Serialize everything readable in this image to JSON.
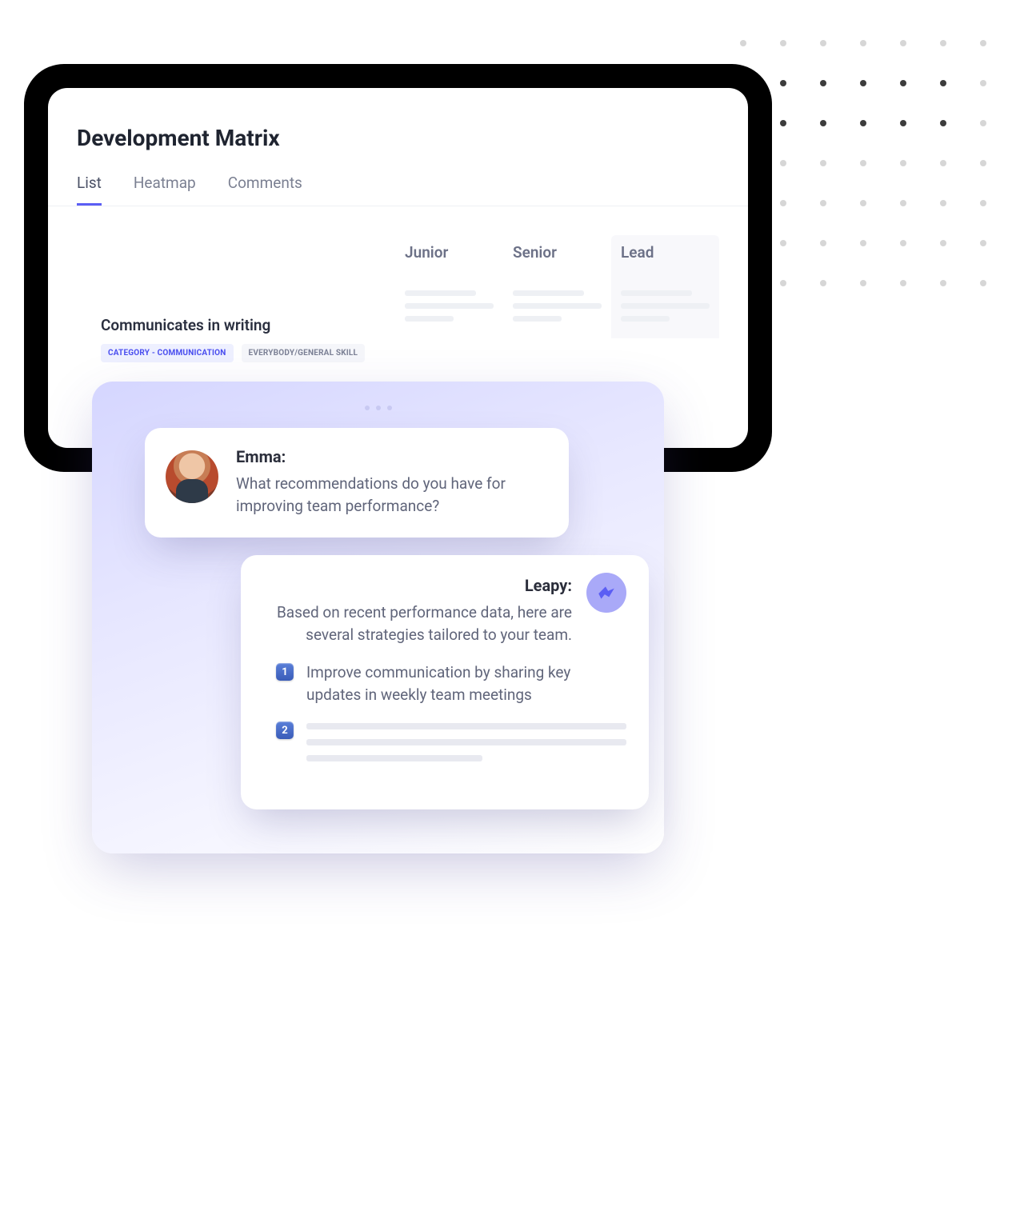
{
  "page": {
    "title": "Development Matrix"
  },
  "tabs": [
    {
      "label": "List",
      "active": true
    },
    {
      "label": "Heatmap",
      "active": false
    },
    {
      "label": "Comments",
      "active": false
    }
  ],
  "matrix": {
    "columns": [
      "Junior",
      "Senior",
      "Lead"
    ],
    "skill": {
      "title": "Communicates in writing",
      "badges": [
        {
          "text": "CATEGORY - COMMUNICATION",
          "variant": "primary"
        },
        {
          "text": "EVERYBODY/GENERAL SKILL",
          "variant": "default"
        }
      ]
    }
  },
  "chat": {
    "user": {
      "name": "Emma:",
      "message": "What recommendations do you have for improving team performance?"
    },
    "bot": {
      "name": "Leapy:",
      "intro": "Based on recent performance data, here are several strategies tailored to your team.",
      "items": [
        {
          "num": "1",
          "text": "Improve communication by sharing key updates in weekly team meetings"
        },
        {
          "num": "2",
          "text": ""
        }
      ]
    }
  }
}
